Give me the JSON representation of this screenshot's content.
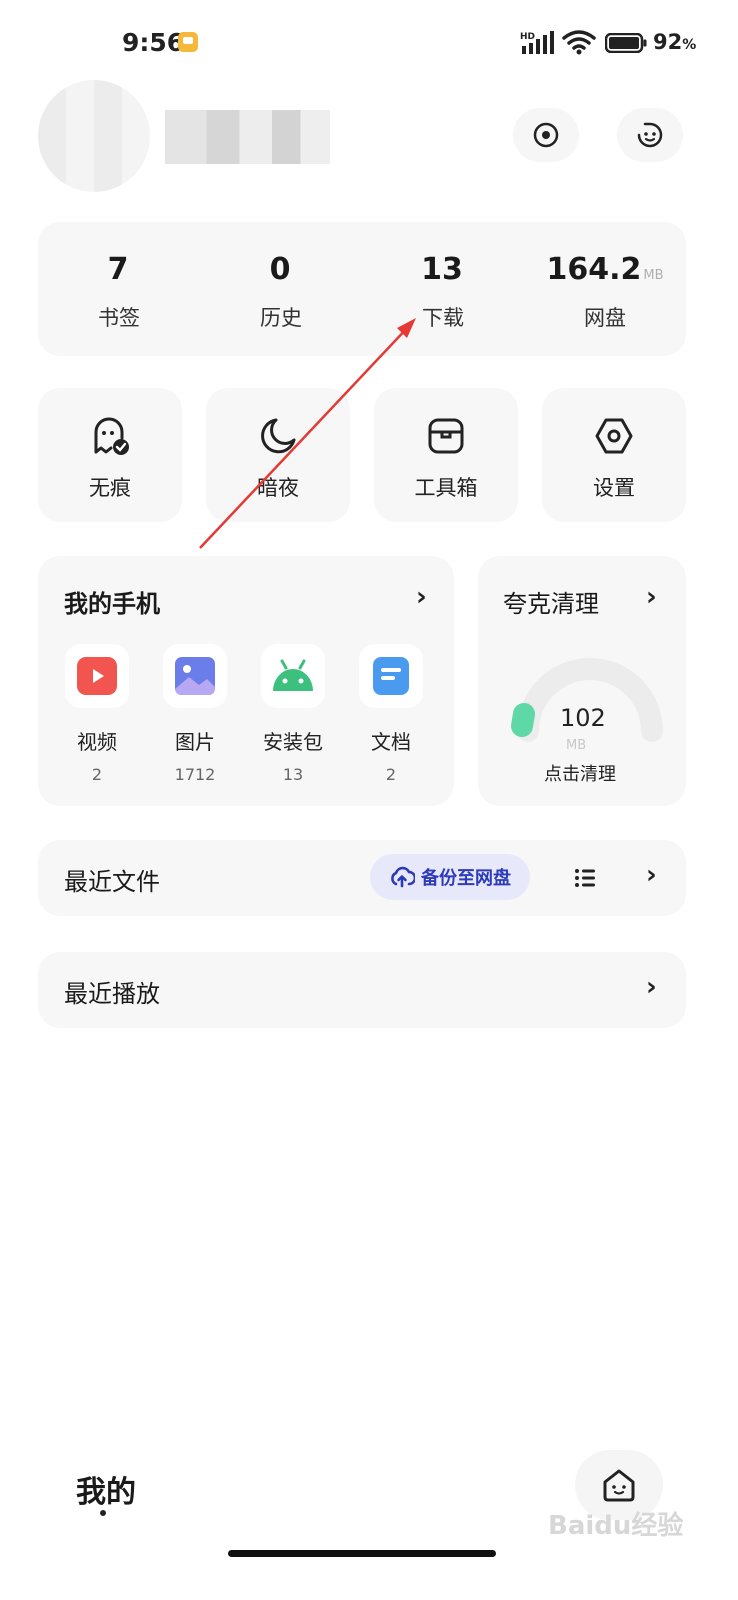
{
  "status_bar": {
    "time": "9:56",
    "network_label": "HD",
    "battery_percent": "92",
    "battery_unit": "%"
  },
  "stats": [
    {
      "value": "7",
      "unit": "",
      "label": "书签"
    },
    {
      "value": "0",
      "unit": "",
      "label": "历史"
    },
    {
      "value": "13",
      "unit": "",
      "label": "下载"
    },
    {
      "value": "164.2",
      "unit": "MB",
      "label": "网盘"
    }
  ],
  "tiles": [
    {
      "label": "无痕",
      "icon": "ghost-check-icon"
    },
    {
      "label": "暗夜",
      "icon": "moon-icon"
    },
    {
      "label": "工具箱",
      "icon": "toolbox-icon"
    },
    {
      "label": "设置",
      "icon": "hexagon-settings-icon"
    }
  ],
  "my_phone": {
    "title": "我的手机",
    "apps": [
      {
        "name": "视频",
        "count": "2",
        "icon": "video-icon",
        "color": "#f2554f"
      },
      {
        "name": "图片",
        "count": "1712",
        "icon": "image-icon",
        "color": "#6b7de8"
      },
      {
        "name": "安装包",
        "count": "13",
        "icon": "android-icon",
        "color": "#3cc07d"
      },
      {
        "name": "文档",
        "count": "2",
        "icon": "document-icon",
        "color": "#4a9bf0"
      }
    ]
  },
  "cleaner": {
    "title": "夸克清理",
    "value": "102",
    "unit": "MB",
    "action": "点击清理",
    "accent": "#5ed8a6"
  },
  "recent_files": {
    "title": "最近文件",
    "backup_label": "备份至网盘",
    "accent": "#2c3bb8"
  },
  "recent_play": {
    "title": "最近播放"
  },
  "bottom_nav": {
    "tab_label": "我的"
  },
  "watermark": "Baidu经验"
}
